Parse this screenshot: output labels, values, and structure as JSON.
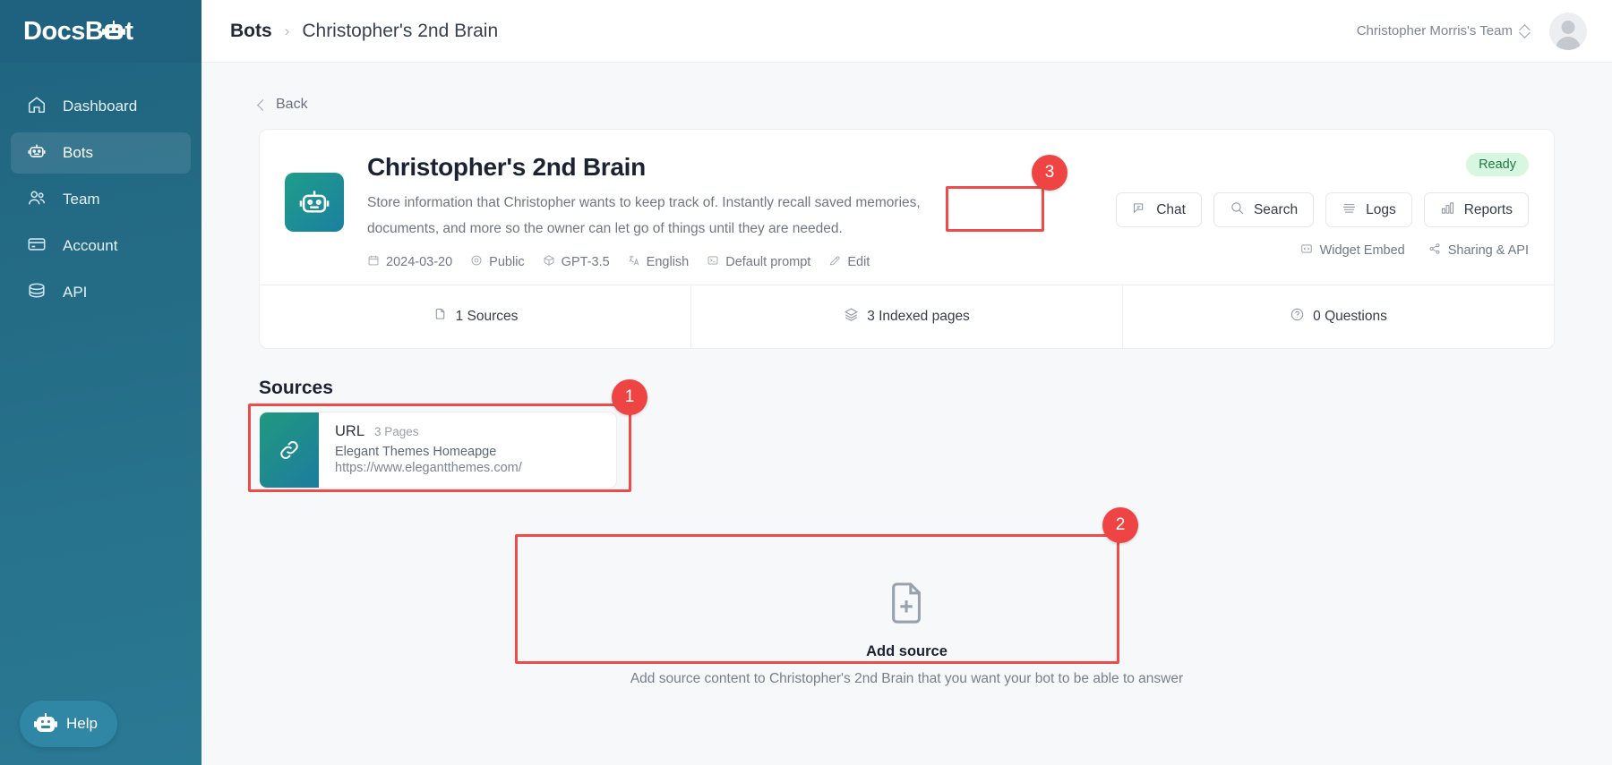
{
  "brand": {
    "name_prefix": "Docs",
    "name_mid": "B",
    "name_suffix": "t",
    "full": "DocsBot"
  },
  "sidebar": {
    "items": [
      {
        "label": "Dashboard",
        "icon": "home-icon",
        "active": false
      },
      {
        "label": "Bots",
        "icon": "robot-icon",
        "active": true
      },
      {
        "label": "Team",
        "icon": "users-icon",
        "active": false
      },
      {
        "label": "Account",
        "icon": "credit-card-icon",
        "active": false
      },
      {
        "label": "API",
        "icon": "server-icon",
        "active": false
      }
    ],
    "help_label": "Help"
  },
  "topbar": {
    "breadcrumb_root": "Bots",
    "breadcrumb_sep": "›",
    "breadcrumb_current": "Christopher's 2nd Brain",
    "team_switcher": "Christopher Morris's Team"
  },
  "page": {
    "back_label": "Back"
  },
  "bot": {
    "title": "Christopher's 2nd Brain",
    "description": "Store information that Christopher wants to keep track of. Instantly recall saved memories, documents, and more so the owner can let go of things until they are needed.",
    "status": "Ready",
    "meta": [
      {
        "label": "2024-03-20",
        "icon": "calendar-icon"
      },
      {
        "label": "Public",
        "icon": "eye-icon"
      },
      {
        "label": "GPT-3.5",
        "icon": "cube-icon"
      },
      {
        "label": "English",
        "icon": "translate-icon"
      },
      {
        "label": "Default prompt",
        "icon": "prompt-icon"
      },
      {
        "label": "Edit",
        "icon": "pencil-icon"
      }
    ],
    "actions": [
      {
        "label": "Chat",
        "icon": "chat-bubble-icon"
      },
      {
        "label": "Search",
        "icon": "magnifier-icon"
      },
      {
        "label": "Logs",
        "icon": "list-lines-icon"
      },
      {
        "label": "Reports",
        "icon": "bar-chart-icon"
      }
    ],
    "sub_links": [
      {
        "label": "Widget Embed",
        "icon": "code-brackets-icon"
      },
      {
        "label": "Sharing & API",
        "icon": "share-icon"
      }
    ],
    "stats": [
      {
        "label": "1 Sources",
        "icon": "document-copy-icon"
      },
      {
        "label": "3 Indexed pages",
        "icon": "layers-icon"
      },
      {
        "label": "0 Questions",
        "icon": "question-circle-icon"
      }
    ]
  },
  "sources": {
    "heading": "Sources",
    "items": [
      {
        "type": "URL",
        "pages": "3 Pages",
        "name": "Elegant Themes Homeapge",
        "url": "https://www.elegantthemes.com/",
        "icon": "link-icon"
      }
    ]
  },
  "add_source": {
    "icon": "document-plus-icon",
    "title": "Add source",
    "description": "Add source content to Christopher's 2nd Brain that you want your bot to be able to answer"
  },
  "annotations": {
    "colors": {
      "accent": "#ef4444",
      "box_border": "#ef4b4b"
    },
    "markers": [
      {
        "number": "1",
        "target": "source-card"
      },
      {
        "number": "2",
        "target": "add-source-panel"
      },
      {
        "number": "3",
        "target": "chat-button"
      }
    ]
  }
}
